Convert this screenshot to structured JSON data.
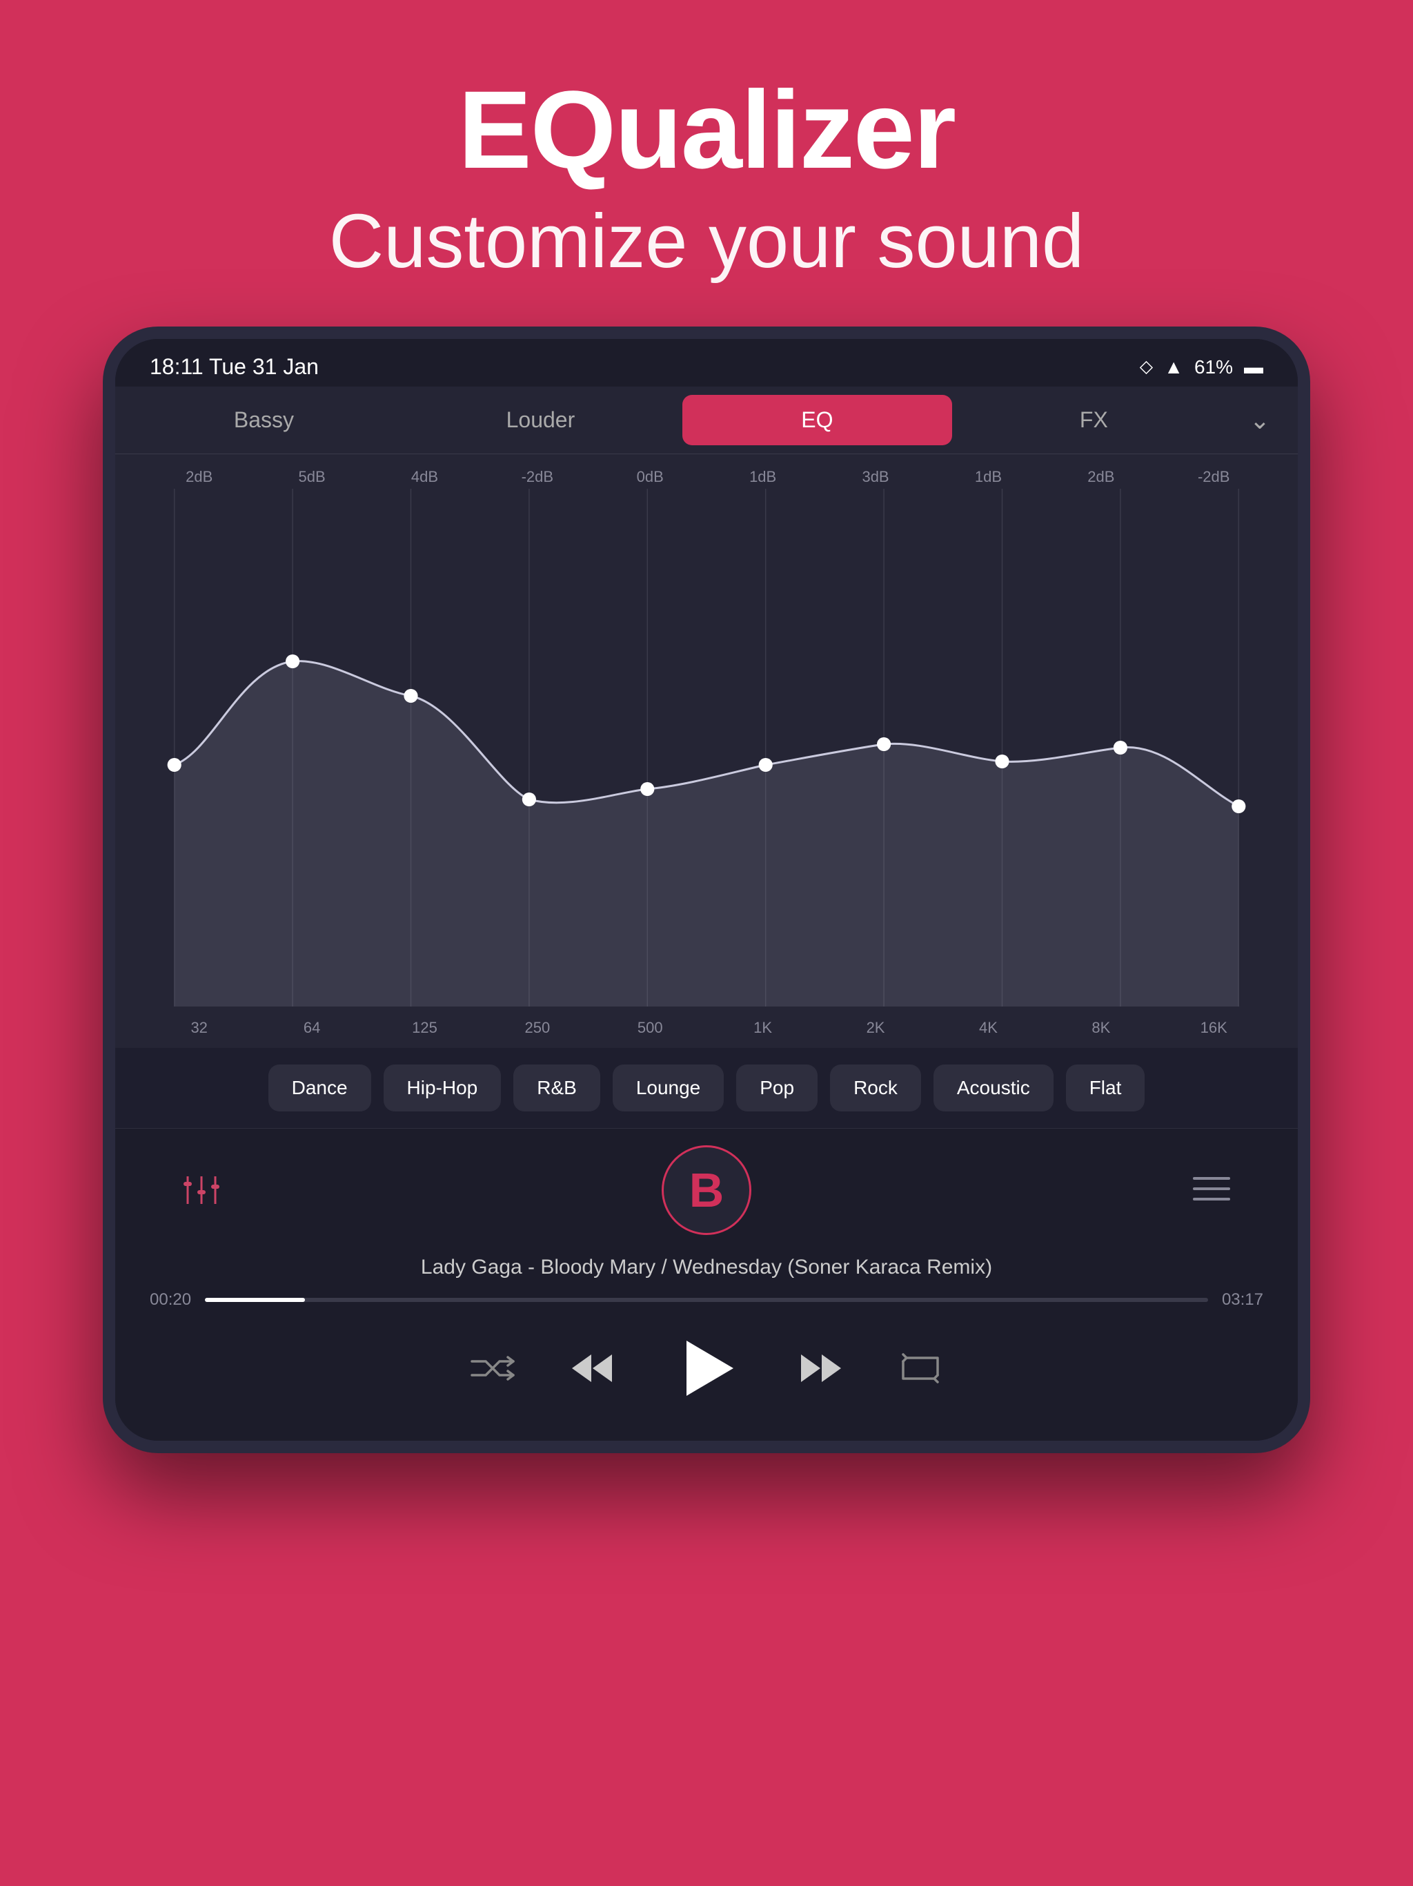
{
  "header": {
    "title": "EQualizer",
    "subtitle": "Customize your sound"
  },
  "status_bar": {
    "time": "18:11  Tue 31 Jan",
    "battery": "61%",
    "icons": "▲ ⬛ 61% 🔋"
  },
  "tabs": [
    {
      "label": "Bassy",
      "active": false
    },
    {
      "label": "Louder",
      "active": false
    },
    {
      "label": "EQ",
      "active": true
    },
    {
      "label": "FX",
      "active": false
    }
  ],
  "eq": {
    "db_labels": [
      "2dB",
      "5dB",
      "4dB",
      "-2dB",
      "0dB",
      "1dB",
      "3dB",
      "1dB",
      "2dB",
      "-2dB"
    ],
    "freq_labels": [
      "32",
      "64",
      "125",
      "250",
      "500",
      "1K",
      "2K",
      "4K",
      "8K",
      "16K"
    ]
  },
  "presets": [
    {
      "label": "Dance",
      "active": false
    },
    {
      "label": "Hip-Hop",
      "active": false
    },
    {
      "label": "R&B",
      "active": false
    },
    {
      "label": "Lounge",
      "active": false
    },
    {
      "label": "Pop",
      "active": false
    },
    {
      "label": "Rock",
      "active": false
    },
    {
      "label": "Acoustic",
      "active": false
    },
    {
      "label": "Flat",
      "active": false
    }
  ],
  "player": {
    "logo_letter": "B",
    "track_name": "Lady Gaga - Bloody Mary / Wednesday (Soner Karaca Remix)",
    "time_current": "00:20",
    "time_total": "03:17",
    "progress_percent": 10
  }
}
